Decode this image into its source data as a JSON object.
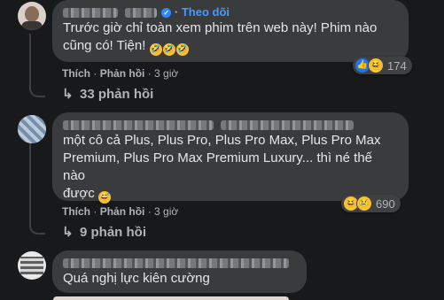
{
  "comments": [
    {
      "author": "",
      "follow_label": "Theo dõi",
      "text_lines": [
        "Trước giờ chỉ toàn xem phim trên web này! Phim nào",
        "cũng có! Tiện!"
      ],
      "emojis": [
        "rofl-emoji",
        "rofl-emoji",
        "rofl-emoji"
      ],
      "like_label": "Thích",
      "reply_label": "Phản hồi",
      "time": "3 giờ",
      "reactions": [
        "like",
        "haha"
      ],
      "reaction_count": "174",
      "replies_label": "33 phản hồi"
    },
    {
      "author": "",
      "text_lines": [
        "một cô cả Plus, Plus Pro, Plus Pro Max, Plus Pro Max",
        "Premium, Plus Pro Max Premium Luxury... thì né thế nào",
        "được"
      ],
      "emojis": [
        "grin-sweat-emoji"
      ],
      "like_label": "Thích",
      "reply_label": "Phản hồi",
      "time": "3 giờ",
      "reactions": [
        "haha",
        "sad"
      ],
      "reaction_count": "690",
      "replies_label": "9 phản hồi"
    },
    {
      "author": "",
      "text_lines": [
        "Quá nghị lực kiên cường"
      ]
    }
  ],
  "separator": "·"
}
